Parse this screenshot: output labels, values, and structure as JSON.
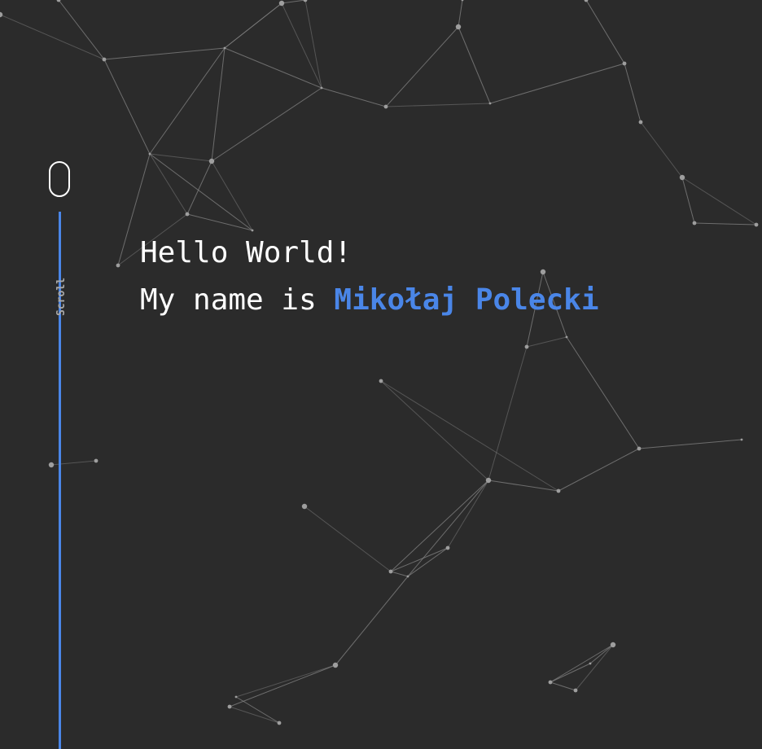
{
  "hero": {
    "greeting": "Hello World!",
    "intro_prefix": "My name is ",
    "name": "Mikołaj Polecki"
  },
  "scroll_indicator": {
    "label": "Scroll"
  },
  "icons": {
    "mouse": "mouse-scroll-icon"
  },
  "colors": {
    "background": "#2b2b2b",
    "accent": "#4a86e8",
    "text": "#ffffff",
    "network_line": "#8a8a8a",
    "network_node": "#9e9e9e"
  }
}
